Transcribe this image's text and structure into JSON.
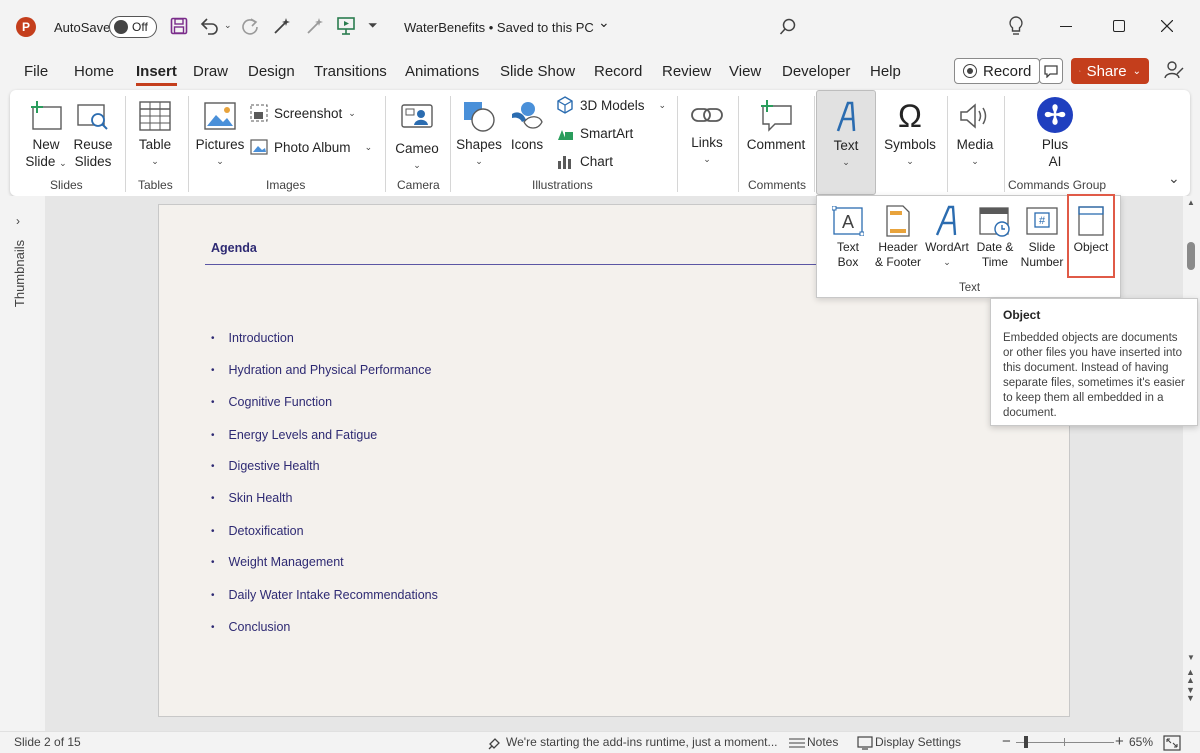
{
  "titlebar": {
    "autosave_label": "AutoSave",
    "autosave_state": "Off",
    "document_title": "WaterBenefits • Saved to this PC",
    "title_chevron": "⌄"
  },
  "tabs": [
    "File",
    "Home",
    "Insert",
    "Draw",
    "Design",
    "Transitions",
    "Animations",
    "Slide Show",
    "Record",
    "Review",
    "View",
    "Developer",
    "Help"
  ],
  "actions": {
    "record_label": "Record",
    "share_label": "Share"
  },
  "ribbon": {
    "new_slide": "New",
    "new_slide_2": "Slide",
    "reuse_slides": "Reuse",
    "reuse_slides_2": "Slides",
    "group_slides": "Slides",
    "table": "Table",
    "group_tables": "Tables",
    "pictures": "Pictures",
    "screenshot": "Screenshot",
    "photo_album": "Photo Album",
    "group_images": "Images",
    "cameo": "Cameo",
    "group_camera": "Camera",
    "shapes": "Shapes",
    "icons": "Icons",
    "models_3d": "3D Models",
    "smartart": "SmartArt",
    "chart": "Chart",
    "group_illustrations": "Illustrations",
    "links": "Links",
    "comment": "Comment",
    "group_comments": "Comments",
    "text": "Text",
    "symbols": "Symbols",
    "media": "Media",
    "plus_ai": "Plus",
    "plus_ai_2": "AI",
    "group_commands": "Commands Group"
  },
  "text_dropdown": {
    "text_box": "Text",
    "text_box_2": "Box",
    "header_footer": "Header",
    "header_footer_2": "& Footer",
    "wordart": "WordArt",
    "date_time": "Date &",
    "date_time_2": "Time",
    "slide_number": "Slide",
    "slide_number_2": "Number",
    "object": "Object",
    "group_label": "Text"
  },
  "tooltip": {
    "title": "Object",
    "body": "Embedded objects are documents or other files you have inserted into this document. Instead of having separate files, sometimes it's easier to keep them all embedded in a document."
  },
  "left_panel": {
    "thumbnails_label": "Thumbnails"
  },
  "slide": {
    "title": "Agenda",
    "bullets": [
      "Introduction",
      "Hydration and Physical Performance",
      "Cognitive Function",
      "Energy Levels and Fatigue",
      "Digestive Health",
      "Skin Health",
      "Detoxification",
      "Weight Management",
      "Daily Water Intake Recommendations",
      "Conclusion"
    ]
  },
  "statusbar": {
    "slide_info": "Slide 2 of 15",
    "addins_message": "We're starting the add-ins runtime, just a moment...",
    "notes_label": "Notes",
    "display_settings": "Display Settings",
    "zoom": "65%"
  },
  "colors": {
    "accent": "#c43e1c",
    "slide_text": "#2e2a73",
    "highlight_box": "#e05a47",
    "plus_ai": "#1f3fbf"
  }
}
